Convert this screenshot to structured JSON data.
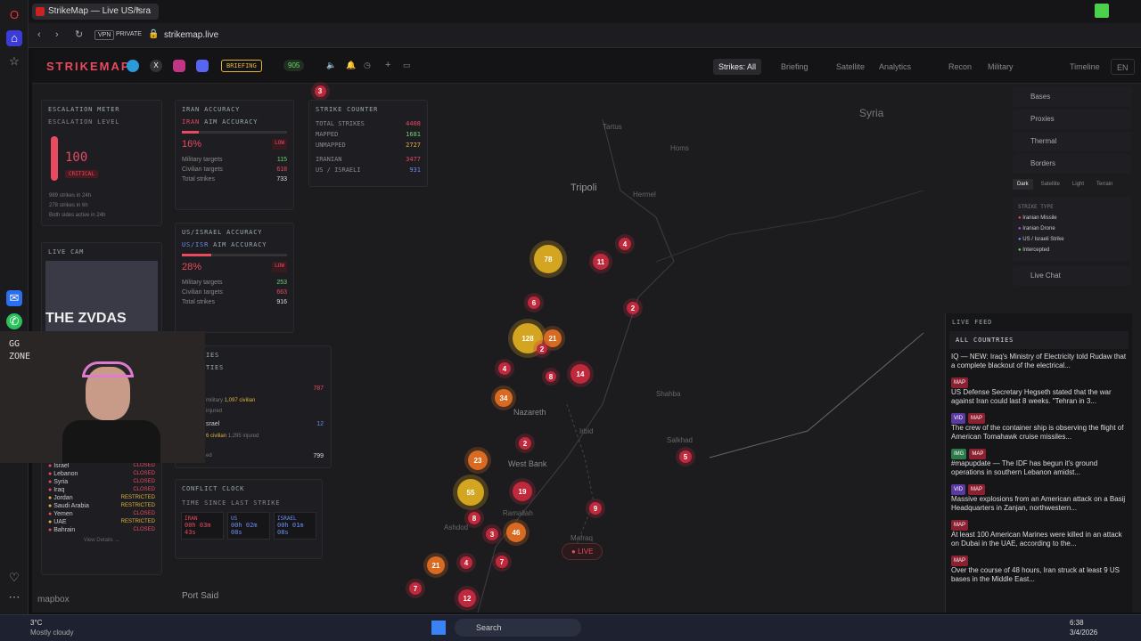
{
  "browser": {
    "tab_title": "StrikeMap — Live US/Isra",
    "url": "strikemap.live",
    "vpn": "VPN",
    "private": "PRIVATE"
  },
  "nav": {
    "logo": "STRIKEMAP",
    "briefing_badge": "BRIEFING",
    "online": "905",
    "strikes_all": "Strikes: All",
    "briefing": "Briefing",
    "satellite": "Satellite",
    "analytics": "Analytics",
    "recon": "Recon",
    "military": "Military",
    "timeline": "Timeline",
    "lang": "EN"
  },
  "escalation": {
    "title": "ESCALATION METER",
    "label": "ESCALATION LEVEL",
    "value": "100",
    "status": "CRITICAL",
    "level_fraction": 1.0,
    "notes": [
      "989 strikes in 24h",
      "278 strikes in 6h",
      "Both sides active in 24h"
    ]
  },
  "livecam": {
    "title": "LIVE CAM"
  },
  "iran_acc": {
    "title": "IRAN ACCURACY",
    "label_a": "IRAN",
    "label_b": "AIM ACCURACY",
    "pct": "16%",
    "grade": "LOW",
    "fill": 0.16,
    "rows": [
      {
        "k": "Military targets",
        "v": "115"
      },
      {
        "k": "Civilian targets",
        "v": "618"
      },
      {
        "k": "Total strikes",
        "v": "733"
      }
    ]
  },
  "us_acc": {
    "title": "US/ISRAEL ACCURACY",
    "label_a": "US/ISR",
    "label_b": "AIM ACCURACY",
    "pct": "28%",
    "grade": "LOW",
    "fill": 0.28,
    "rows": [
      {
        "k": "Military targets",
        "v": "253"
      },
      {
        "k": "Civilian targets",
        "v": "663"
      },
      {
        "k": "Total strikes",
        "v": "916"
      }
    ]
  },
  "counter": {
    "title": "STRIKE COUNTER",
    "rows": [
      {
        "k": "TOTAL STRIKES",
        "v": "4408"
      },
      {
        "k": "MAPPED",
        "v": "1681"
      },
      {
        "k": "UNMAPPED",
        "v": "2727"
      },
      {
        "k": "IRANIAN",
        "v": "3477"
      },
      {
        "k": "US / ISRAELI",
        "v": "931"
      }
    ]
  },
  "casualties": {
    "title": "IES",
    "sub": "TIES",
    "r1": "787",
    "r2": "12",
    "military": "military",
    "civ1": "1,097 civilian",
    "injured": "injured",
    "israel": "srael",
    "civ2": "6 civilian",
    "inj2": "1,295 injured",
    "total": "799",
    "footer": "ed"
  },
  "airspace": {
    "rows": [
      {
        "k": "Israel",
        "v": "CLOSED"
      },
      {
        "k": "Lebanon",
        "v": "CLOSED"
      },
      {
        "k": "Syria",
        "v": "CLOSED"
      },
      {
        "k": "Iraq",
        "v": "CLOSED"
      },
      {
        "k": "Jordan",
        "v": "RESTRICTED"
      },
      {
        "k": "Saudi Arabia",
        "v": "RESTRICTED"
      },
      {
        "k": "Yemen",
        "v": "CLOSED"
      },
      {
        "k": "UAE",
        "v": "RESTRICTED"
      },
      {
        "k": "Bahrain",
        "v": "CLOSED"
      }
    ],
    "view": "View Details →"
  },
  "clock": {
    "title": "CONFLICT CLOCK",
    "sub": "TIME SINCE LAST STRIKE",
    "cells": [
      {
        "k": "IRAN",
        "v": "00h 03m 43s"
      },
      {
        "k": "US",
        "v": "00h 02m 08s"
      },
      {
        "k": "ISRAEL",
        "v": "00h 01m 08s"
      }
    ]
  },
  "map": {
    "labels": [
      "Syria",
      "Tripoli",
      "Homs",
      "Nazareth",
      "West Bank",
      "Irbid",
      "Port Said",
      "Tartus",
      "Hermel",
      "Shahba",
      "Salkhad",
      "Ramallah",
      "Ashdod",
      "Mafraq"
    ],
    "live": "LIVE",
    "attribution": "mapbox"
  },
  "rightmenu": {
    "items": [
      "Bases",
      "Proxies",
      "Thermal",
      "Borders"
    ],
    "styles": [
      "Dark",
      "Satellite",
      "Light",
      "Terrain"
    ],
    "legend_title": "STRIKE TYPE",
    "legend": [
      "Iranian Missile",
      "Iranian Drone",
      "US / Israeli Strike",
      "Intercepted"
    ],
    "chat": "Live Chat"
  },
  "feed": {
    "title": "LIVE FEED",
    "filter": "ALL COUNTRIES",
    "items": [
      {
        "tags": [],
        "text": "IQ — NEW: Iraq's Ministry of Electricity told Rudaw that a complete blackout of the electrical..."
      },
      {
        "tags": [
          "MAP"
        ],
        "text": "US Defense Secretary Hegseth stated that the war against Iran could last 8 weeks. \"Tehran in 3..."
      },
      {
        "tags": [
          "VID",
          "MAP"
        ],
        "text": "The crew of the container ship is observing the flight of American Tomahawk cruise missiles..."
      },
      {
        "tags": [
          "IMG",
          "MAP"
        ],
        "text": "#mapupdate — The IDF has begun it's ground operations in southern Lebanon amidst..."
      },
      {
        "tags": [
          "VID",
          "MAP"
        ],
        "text": "Massive explosions from an American attack on a Basij Headquarters in Zanjan, northwestern..."
      },
      {
        "tags": [
          "MAP"
        ],
        "text": "At least 100 American Marines were killed in an attack on Dubai in the UAE, according to the..."
      },
      {
        "tags": [
          "MAP"
        ],
        "text": "Over the course of 48 hours, Iran struck at least 9 US bases in the Middle East..."
      }
    ]
  },
  "clusters": [
    {
      "n": "3",
      "c": "red"
    },
    {
      "n": "78",
      "c": "yel"
    },
    {
      "n": "11",
      "c": "red"
    },
    {
      "n": "4",
      "c": "red"
    },
    {
      "n": "2",
      "c": "red"
    },
    {
      "n": "6",
      "c": "red"
    },
    {
      "n": "128",
      "c": "yel"
    },
    {
      "n": "21",
      "c": "org"
    },
    {
      "n": "2",
      "c": "red"
    },
    {
      "n": "4",
      "c": "red"
    },
    {
      "n": "8",
      "c": "red"
    },
    {
      "n": "14",
      "c": "red"
    },
    {
      "n": "34",
      "c": "org"
    },
    {
      "n": "2",
      "c": "red"
    },
    {
      "n": "23",
      "c": "org"
    },
    {
      "n": "5",
      "c": "red"
    },
    {
      "n": "55",
      "c": "yel"
    },
    {
      "n": "19",
      "c": "red"
    },
    {
      "n": "8",
      "c": "red"
    },
    {
      "n": "9",
      "c": "red"
    },
    {
      "n": "3",
      "c": "red"
    },
    {
      "n": "46",
      "c": "org"
    },
    {
      "n": "4",
      "c": "red"
    },
    {
      "n": "7",
      "c": "red"
    },
    {
      "n": "21",
      "c": "org"
    },
    {
      "n": "7",
      "c": "red"
    },
    {
      "n": "12",
      "c": "red"
    }
  ],
  "taskbar": {
    "temp": "3°C",
    "weather": "Mostly cloudy",
    "search": "Search",
    "time": "6:38",
    "date": "3/4/2026"
  },
  "webcam": {
    "overlay": "GG ZONE"
  }
}
